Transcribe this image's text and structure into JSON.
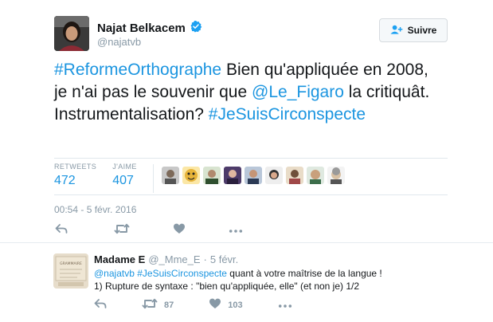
{
  "author": {
    "name": "Najat Belkacem",
    "handle": "@najatvb",
    "verified": true
  },
  "follow_button": {
    "label": "Suivre"
  },
  "tweet": {
    "hashtag1": "#ReformeOrthographe",
    "text1": " Bien qu'appliquée en 2008, je n'ai pas le souvenir que ",
    "mention": "@Le_Figaro",
    "text2": " la critiquât. Instrumentalisation? ",
    "hashtag2": "#JeSuisCirconspecte"
  },
  "stats": {
    "retweets_label": "RETWEETS",
    "retweets_value": "472",
    "likes_label": "J'AIME",
    "likes_value": "407"
  },
  "timestamp": "00:54 - 5 févr. 2016",
  "colors": {
    "link": "#1b95e0",
    "muted": "#8899a6",
    "verified": "#1da1f2"
  },
  "reply": {
    "name": "Madame E",
    "handle": "@_Mme_E",
    "separator": "·",
    "date": "5 févr.",
    "mention": "@najatvb",
    "hashtag": "#JeSuisCirconspecte",
    "text1": " quant à votre maîtrise de la langue !",
    "text2": "1) Rupture de syntaxe : \"bien qu'appliquée, elle\" (et non je) 1/2",
    "retweets": "87",
    "likes": "103",
    "avatar_caption": "GRAMMAIRE"
  },
  "icons": {
    "follow": "add-user-icon",
    "verified": "verified-badge-icon",
    "reply": "reply-icon",
    "retweet": "retweet-icon",
    "like": "heart-icon",
    "more": "more-icon"
  }
}
